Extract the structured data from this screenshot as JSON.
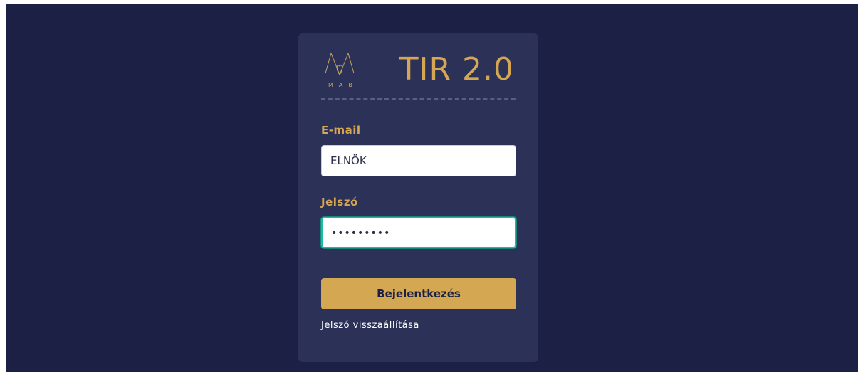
{
  "brand": {
    "logo_text": "MAB",
    "app_title": "TIR 2.0",
    "accent_color": "#d5a754"
  },
  "form": {
    "email_label": "E-mail",
    "email_value": "ELNÖK",
    "password_label": "Jelszó",
    "password_value": "•••••••••",
    "login_button": "Bejelentkezés",
    "reset_link": "Jelszó visszaállítása"
  },
  "colors": {
    "background": "#1c2044",
    "card": "#2c3157",
    "focus_border": "#1fb9a6"
  }
}
